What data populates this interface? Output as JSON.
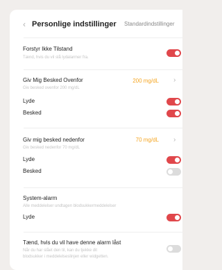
{
  "header": {
    "back_icon": "chevron-left-icon",
    "title": "Personlige indstillinger",
    "default_link": "Standardindstillinger"
  },
  "dnd": {
    "label": "Forstyr Ikke Tilstand",
    "desc": "Tænd, hvis du vil slå lydalarmer fra.",
    "enabled": true
  },
  "high": {
    "label": "Giv Mig Besked Ovenfor",
    "desc": "Giv besked ovenfor 200 mg/dL",
    "value": "200 mg/dL",
    "sound_label": "Lyde",
    "sound_enabled": true,
    "notify_label": "Besked",
    "notify_enabled": true
  },
  "low": {
    "label": "Giv mig besked nedenfor",
    "desc": "Giv besked nedenfor 70 mg/dL",
    "value": "70 mg/dL",
    "sound_label": "Lyde",
    "sound_enabled": true,
    "notify_label": "Besked",
    "notify_enabled": false
  },
  "system": {
    "label": "System-alarm",
    "desc": "Alle meddelelser undtagen blodsukkermeddelelser",
    "sound_label": "Lyde",
    "sound_enabled": true
  },
  "lock": {
    "label": "Tænd, hvis du vil have denne alarm låst",
    "desc_line1": "Når du har slået den til, kan du tjekke dit",
    "desc_line2": "blodsukker i meddelelseslinjen eller widgetten.",
    "enabled": false
  },
  "colors": {
    "accent": "#e0474b",
    "value": "#f5a623",
    "toggle_off": "#dcdcdc"
  }
}
